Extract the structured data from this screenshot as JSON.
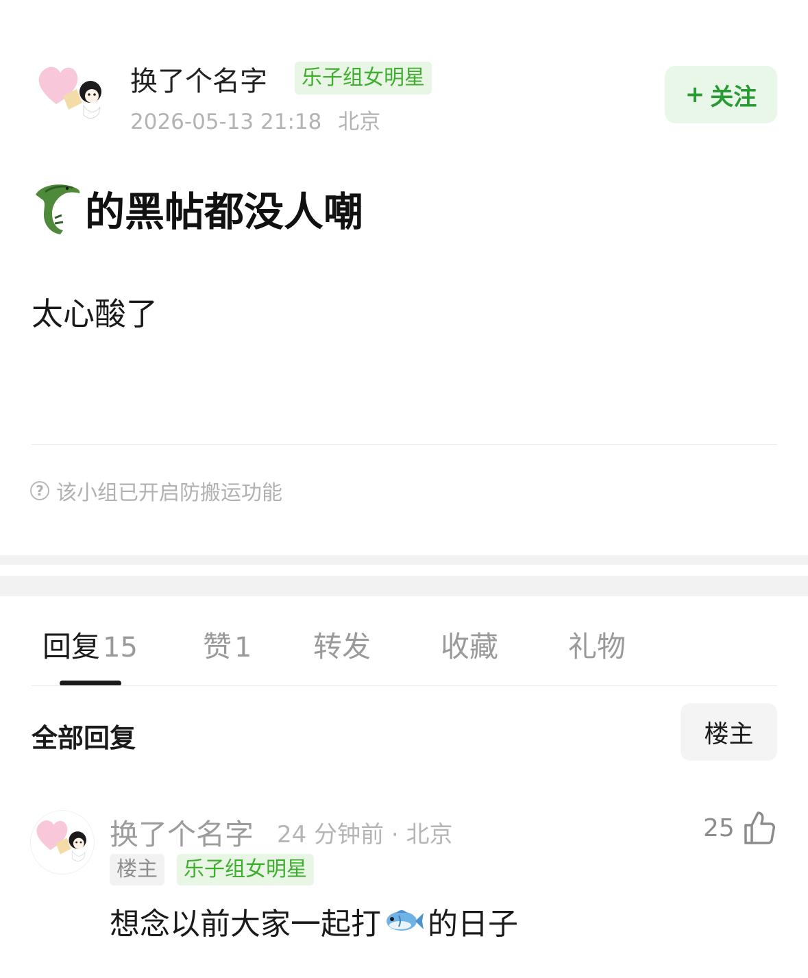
{
  "post": {
    "author_name": "换了个名字",
    "author_group_tag": "乐子组女明星",
    "datetime": "2026-05-13 21:18",
    "location": "北京",
    "follow_plus": "+",
    "follow_label": "关注",
    "title_emoji": "crocodile-icon",
    "title_text": "的黑帖都没人嘲",
    "body_text": "太心酸了",
    "notice_icon": "question-circle-icon",
    "notice_text": "该小组已开启防搬运功能"
  },
  "tabs": [
    {
      "label": "回复",
      "count": "15",
      "active": true
    },
    {
      "label": "赞",
      "count": "1",
      "active": false
    },
    {
      "label": "转发",
      "count": "",
      "active": false
    },
    {
      "label": "收藏",
      "count": "",
      "active": false
    },
    {
      "label": "礼物",
      "count": "",
      "active": false
    }
  ],
  "replies_section": {
    "title": "全部回复",
    "filter_button": "楼主"
  },
  "reply": {
    "author_name": "换了个名字",
    "time_location": "24 分钟前 · 北京",
    "like_count": "25",
    "like_icon": "thumbs-up-icon",
    "owner_tag": "楼主",
    "group_tag": "乐子组女明星",
    "text_before": "想念以前大家一起打",
    "emoji": "fish-icon",
    "text_after": "的日子"
  },
  "colors": {
    "accent_green": "#2a9a35",
    "tag_green_text": "#3fae2f",
    "tag_green_bg": "#e9f6e6",
    "muted_text": "#b3b3b3",
    "separator_band": "#f2f2f2"
  }
}
